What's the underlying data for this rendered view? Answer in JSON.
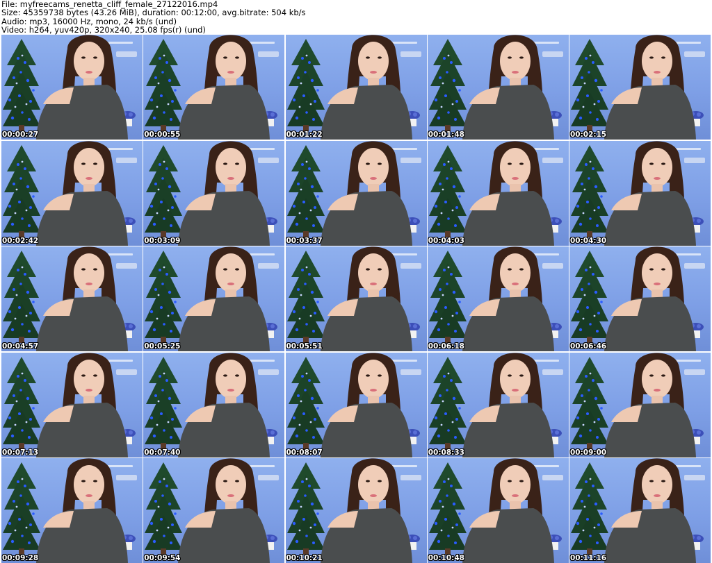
{
  "header": {
    "line1": "File: myfreecams_renetta_cliff_female_27122016.mp4",
    "line2": "Size: 45359738 bytes (43.26 MiB), duration: 00:12:00, avg.bitrate: 504 kb/s",
    "line3": "Audio: mp3, 16000 Hz, mono, 24 kb/s (und)",
    "line4": "Video: h264, yuv420p, 320x240, 25.08 fps(r) (und)"
  },
  "thumbnails": [
    {
      "timestamp": "00:00:27"
    },
    {
      "timestamp": "00:00:55"
    },
    {
      "timestamp": "00:01:22"
    },
    {
      "timestamp": "00:01:48"
    },
    {
      "timestamp": "00:02:15"
    },
    {
      "timestamp": "00:02:42"
    },
    {
      "timestamp": "00:03:09"
    },
    {
      "timestamp": "00:03:37"
    },
    {
      "timestamp": "00:04:03"
    },
    {
      "timestamp": "00:04:30"
    },
    {
      "timestamp": "00:04:57"
    },
    {
      "timestamp": "00:05:25"
    },
    {
      "timestamp": "00:05:51"
    },
    {
      "timestamp": "00:06:18"
    },
    {
      "timestamp": "00:06:46"
    },
    {
      "timestamp": "00:07:13"
    },
    {
      "timestamp": "00:07:40"
    },
    {
      "timestamp": "00:08:07"
    },
    {
      "timestamp": "00:08:33"
    },
    {
      "timestamp": "00:09:00"
    },
    {
      "timestamp": "00:09:28"
    },
    {
      "timestamp": "00:09:54"
    },
    {
      "timestamp": "00:10:21"
    },
    {
      "timestamp": "00:10:48"
    },
    {
      "timestamp": "00:11:16"
    }
  ],
  "colors": {
    "background": "#ffffff",
    "wall": "#8fb0ee",
    "tree": "#1f4a2c",
    "tree_lights": "#2a5cff",
    "hair": "#3a2218",
    "sweater": "#4a4d4e",
    "skin": "#f0cdb8"
  }
}
